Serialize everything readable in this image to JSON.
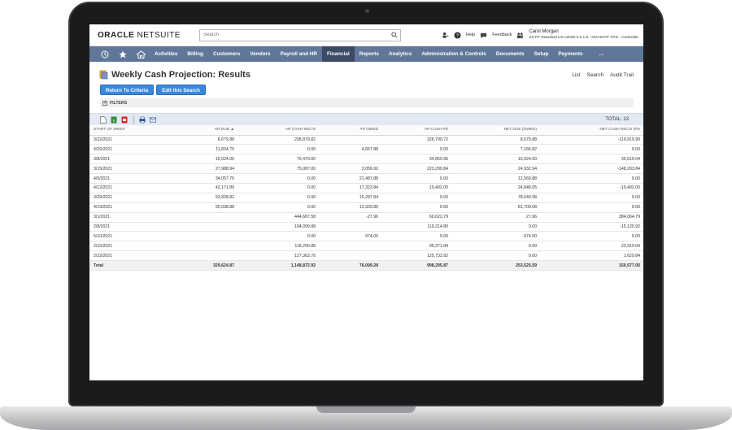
{
  "app": {
    "logo_oracle": "ORACLE",
    "logo_netsuite": "NETSUITE",
    "search_placeholder": "Search",
    "help_label": "Help",
    "feedback_label": "Feedback",
    "user_name": "Carol Morgan",
    "user_role": "SS FF Standard US v2020.2.0 1.5 - NOAM FF STD - Controller"
  },
  "nav": {
    "items": [
      "Activities",
      "Billing",
      "Customers",
      "Vendors",
      "Payroll and HR",
      "Financial",
      "Reports",
      "Analytics",
      "Administration & Controls",
      "Documents",
      "Setup",
      "Payments",
      "..."
    ],
    "active": "Financial"
  },
  "page": {
    "title": "Weekly Cash Projection: Results",
    "links": [
      "List",
      "Search",
      "Audit Trail"
    ],
    "return_button": "Return To Criteria",
    "edit_button": "Edit this Search",
    "filters_label": "FILTERS",
    "total_label": "TOTAL: 13"
  },
  "table": {
    "columns": [
      "START OF WEEK",
      "AR DUE ▲",
      "AR CASH REC'D",
      "AP OWED",
      "AP CASH PD",
      "NET DUE (OWED)",
      "NET CASH REC'D (PD"
    ],
    "rows": [
      [
        "3/22/2021",
        "8,679.88",
        "208,879.82",
        "",
        "328,799.72",
        "8,679.88",
        "-119,919.90"
      ],
      [
        "4/26/2021",
        "11,834.70",
        "0.00",
        "4,667.88",
        "0.00",
        "7,166.82",
        "0.00"
      ],
      [
        "3/8/2021",
        "16,024.00",
        "70,470.00",
        "",
        "34,859.96",
        "16,024.00",
        "35,610.04"
      ],
      [
        "3/15/2021",
        "27,988.94",
        "75,087.00",
        "3,056.00",
        "223,290.84",
        "24,932.94",
        "-148,203.84"
      ],
      [
        "4/5/2021",
        "34,057.76",
        "0.00",
        "21,487.88",
        "0.00",
        "12,569.88",
        "0.00"
      ],
      [
        "4/12/2021",
        "42,171.89",
        "0.00",
        "17,323.84",
        "10,402.00",
        "24,848.05",
        "-10,402.00"
      ],
      [
        "3/29/2021",
        "93,828.82",
        "0.00",
        "15,287.84",
        "0.00",
        "78,540.98",
        "0.00"
      ],
      [
        "4/19/2021",
        "95,038.88",
        "0.00",
        "13,329.80",
        "0.00",
        "81,709.08",
        "0.00"
      ],
      [
        "3/1/2021",
        "",
        "444,687.58",
        "-27.96",
        "60,622.79",
        "27.96",
        "384,064.79"
      ],
      [
        "2/8/2021",
        "",
        "104,099.88",
        "",
        "119,214.80",
        "0.00",
        "-15,120.92"
      ],
      [
        "5/10/2021",
        "",
        "0.00",
        "974.00",
        "0.00",
        "-974.00",
        "0.00"
      ],
      [
        "2/15/2021",
        "",
        "118,290.88",
        "",
        "95,371.84",
        "0.00",
        "22,919.04"
      ],
      [
        "2/22/2021",
        "",
        "127,363.76",
        "",
        "125,733.92",
        "0.00",
        "1,629.84"
      ]
    ],
    "total": [
      "Total",
      "329,624.87",
      "1,148,872.92",
      "76,099.28",
      "998,295.87",
      "253,525.59",
      "150,577.05"
    ]
  },
  "colors": {
    "nav_bg": "#607799",
    "nav_active": "#3b4b66",
    "button": "#3a87dd",
    "toolbar_bg": "#e3e9f2"
  },
  "icons": {
    "toolbar": [
      "new-document-icon",
      "export-excel-icon",
      "export-pdf-icon",
      "print-icon",
      "email-icon"
    ],
    "nav": [
      "recent-icon",
      "star-icon",
      "home-icon"
    ]
  }
}
